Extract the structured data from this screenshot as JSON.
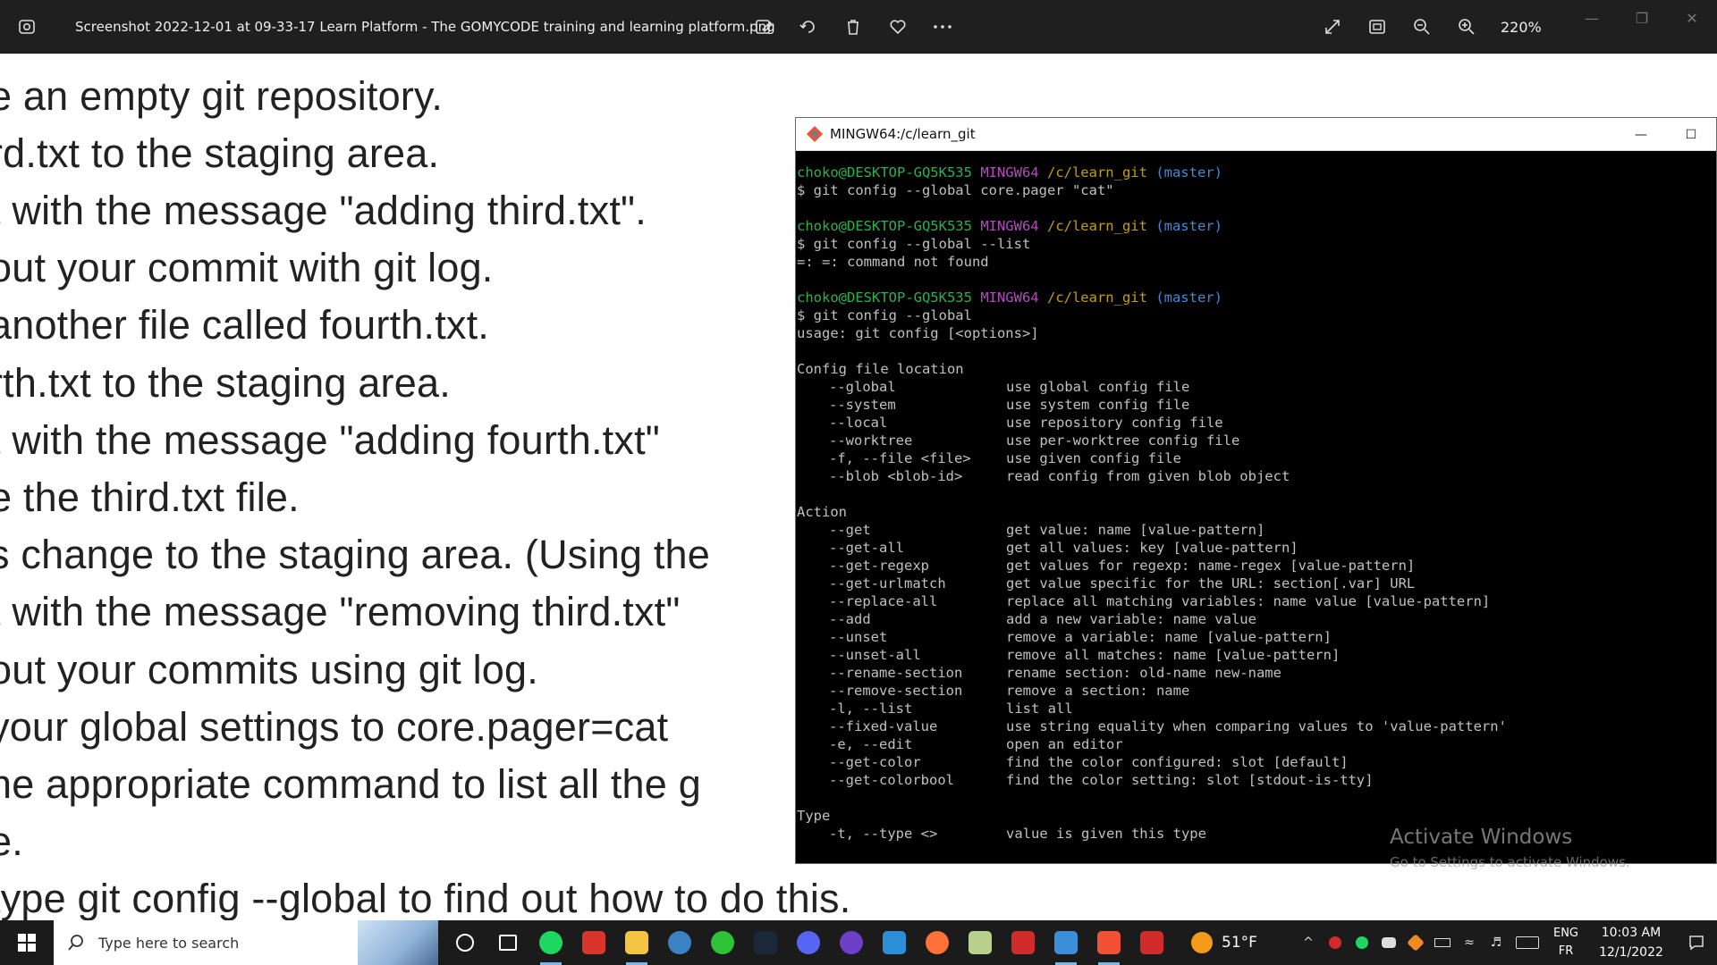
{
  "photos_bar": {
    "file_title": "Screenshot 2022-12-01 at 09-33-17 Learn Platform - The GOMYCODE training and learning platform.png",
    "zoom_level": "220%",
    "tool_icons": [
      "edit-image-icon",
      "rotate-icon",
      "delete-icon",
      "favorite-icon",
      "more-icon"
    ],
    "view_icons": [
      "fullscreen-icon",
      "fit-icon",
      "zoom-out-icon",
      "zoom-in-icon"
    ]
  },
  "background_lines": [
    "e an empty git repository.",
    "rd.txt to the staging area.",
    "t with the message \"adding third.txt\".",
    "out your commit with git log.",
    "another file called fourth.txt.",
    "rth.txt to the staging area.",
    "t with the message \"adding fourth.txt\"",
    "e the third.txt file.",
    "s change to the staging area. (Using the",
    "t with the message \"removing third.txt\"",
    "out your commits using git log.",
    " your global settings to core.pager=cat",
    "he appropriate command to list all the g",
    "e.",
    " type git config --global to find out how to do this."
  ],
  "terminal": {
    "title": "MINGW64:/c/learn_git",
    "prompt": {
      "user": "choko@DESKTOP-GQ5K535",
      "system": "MINGW64",
      "path": "/c/learn_git",
      "branch": "(master)"
    },
    "cmd1": "$ git config --global core.pager \"cat\"",
    "cmd2": "$ git config --global --list",
    "out2": "=: =: command not found",
    "cmd3": "$ git config --global",
    "usage": "usage: git config [<options>]",
    "section_location": "Config file location",
    "location_opts": [
      {
        "opt": "--global",
        "desc": "use global config file"
      },
      {
        "opt": "--system",
        "desc": "use system config file"
      },
      {
        "opt": "--local",
        "desc": "use repository config file"
      },
      {
        "opt": "--worktree",
        "desc": "use per-worktree config file"
      },
      {
        "opt": "-f, --file <file>",
        "desc": "use given config file"
      },
      {
        "opt": "--blob <blob-id>",
        "desc": "read config from given blob object"
      }
    ],
    "section_action": "Action",
    "action_opts": [
      {
        "opt": "--get",
        "desc": "get value: name [value-pattern]"
      },
      {
        "opt": "--get-all",
        "desc": "get all values: key [value-pattern]"
      },
      {
        "opt": "--get-regexp",
        "desc": "get values for regexp: name-regex [value-pattern]"
      },
      {
        "opt": "--get-urlmatch",
        "desc": "get value specific for the URL: section[.var] URL"
      },
      {
        "opt": "--replace-all",
        "desc": "replace all matching variables: name value [value-pattern]"
      },
      {
        "opt": "--add",
        "desc": "add a new variable: name value"
      },
      {
        "opt": "--unset",
        "desc": "remove a variable: name [value-pattern]"
      },
      {
        "opt": "--unset-all",
        "desc": "remove all matches: name [value-pattern]"
      },
      {
        "opt": "--rename-section",
        "desc": "rename section: old-name new-name"
      },
      {
        "opt": "--remove-section",
        "desc": "remove a section: name"
      },
      {
        "opt": "-l, --list",
        "desc": "list all"
      },
      {
        "opt": "--fixed-value",
        "desc": "use string equality when comparing values to 'value-pattern'"
      },
      {
        "opt": "-e, --edit",
        "desc": "open an editor"
      },
      {
        "opt": "--get-color",
        "desc": "find the color configured: slot [default]"
      },
      {
        "opt": "--get-colorbool",
        "desc": "find the color setting: slot [stdout-is-tty]"
      }
    ],
    "section_type": "Type",
    "type_opts": [
      {
        "opt": "-t, --type <>",
        "desc": "value is given this type"
      }
    ]
  },
  "watermark": {
    "title": "Activate Windows",
    "subtitle": "Go to Settings to activate Windows."
  },
  "taskbar": {
    "search_placeholder": "Type here to search",
    "weather": "51°F",
    "lang_top": "ENG",
    "lang_bottom": "FR",
    "time": "10:03 AM",
    "date": "12/1/2022",
    "app_icons": [
      {
        "name": "cortana-icon",
        "color": "#1b1b1b"
      },
      {
        "name": "task-view-icon",
        "color": "#1b1b1b"
      },
      {
        "name": "spotify-icon",
        "color": "#1ed760"
      },
      {
        "name": "voicemeeter-icon",
        "color": "#d9352b"
      },
      {
        "name": "file-explorer-icon",
        "color": "#f4c542"
      },
      {
        "name": "qbittorrent-icon",
        "color": "#3b82c4"
      },
      {
        "name": "razer-icon",
        "color": "#2ec238"
      },
      {
        "name": "steam-icon",
        "color": "#1b2838"
      },
      {
        "name": "discord-ptb-icon",
        "color": "#5865f2"
      },
      {
        "name": "github-desktop-icon",
        "color": "#6e40c9"
      },
      {
        "name": "vscode-icon",
        "color": "#2c8ed6"
      },
      {
        "name": "firefox-icon",
        "color": "#ff7139"
      },
      {
        "name": "edge-icon",
        "color": "#b9cf8c"
      },
      {
        "name": "app-a-icon",
        "color": "#d22b2b"
      },
      {
        "name": "photos-icon",
        "color": "#3a8fd8"
      },
      {
        "name": "git-bash-icon",
        "color": "#f05033"
      },
      {
        "name": "app-b-icon",
        "color": "#d22b2b"
      }
    ]
  },
  "colors": {
    "prompt_user": "#29b34a",
    "prompt_system": "#b44bbf",
    "prompt_path": "#c4a000",
    "prompt_branch": "#3f8bd6"
  }
}
